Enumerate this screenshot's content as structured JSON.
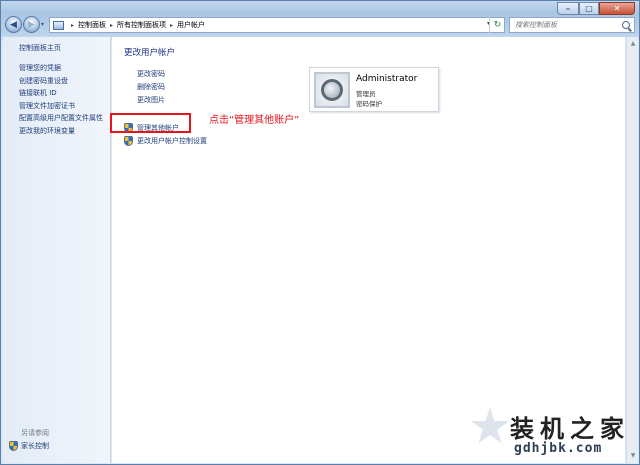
{
  "window": {
    "caption_buttons": {
      "minimize": "–",
      "maximize": "□",
      "close": "✕"
    }
  },
  "navbar": {
    "back_glyph": "◀",
    "forward_glyph": "▶",
    "recent_glyph": "▾",
    "breadcrumb": [
      "控制面板",
      "所有控制面板项",
      "用户帐户"
    ],
    "separator": "▸",
    "dropdown_glyph": "▾",
    "refresh_glyph": "↻",
    "search_placeholder": "搜索控制面板"
  },
  "left_pane": {
    "title": "控制面板主页",
    "links": [
      "管理您的凭据",
      "创建密码重设盘",
      "链接联机 ID",
      "管理文件加密证书",
      "配置高级用户配置文件属性",
      "更改我的环境变量"
    ],
    "see_also": "另请参阅",
    "parental_control": "家长控制"
  },
  "main": {
    "title": "更改用户帐户",
    "tasks": [
      "更改密码",
      "删除密码",
      "更改图片"
    ],
    "actions": [
      "管理其他帐户",
      "更改用户帐户控制设置"
    ],
    "annotation": "点击“管理其他账户”"
  },
  "account": {
    "name": "Administrator",
    "type": "管理员",
    "status": "密码保护"
  },
  "scrollbar": {
    "up": "▲",
    "down": "▼"
  },
  "watermark": {
    "text": "装机之家",
    "url": "gdhjbk.com"
  },
  "colors": {
    "link": "#1f3d7a",
    "annotation": "#e8131b",
    "title": "#1e3287"
  }
}
